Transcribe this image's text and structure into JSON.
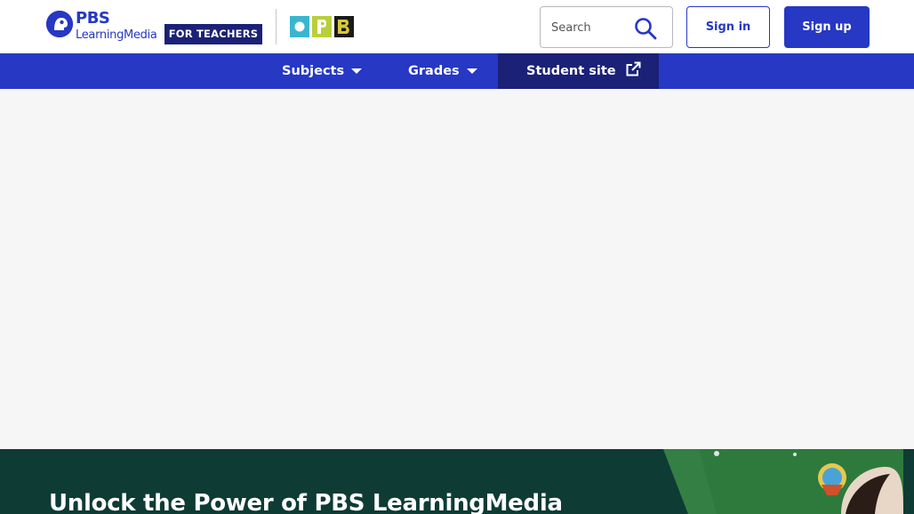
{
  "header": {
    "logo_primary": "PBS",
    "logo_secondary": "LearningMedia",
    "audience_badge": "FOR TEACHERS",
    "partner_logo": "OPB",
    "search": {
      "placeholder": "Search",
      "value": ""
    },
    "signin_label": "Sign in",
    "signup_label": "Sign up"
  },
  "nav": {
    "items": [
      {
        "label": "Subjects",
        "has_dropdown": true
      },
      {
        "label": "Grades",
        "has_dropdown": true
      },
      {
        "label": "Student site",
        "external": true
      }
    ]
  },
  "promo": {
    "title": "Unlock the Power of PBS LearningMedia"
  },
  "icons": {
    "pbs": "pbs-head-icon",
    "search": "search-icon",
    "caret": "caret-down-icon",
    "external": "external-link-icon"
  },
  "colors": {
    "brand_blue": "#2638c4",
    "navy": "#1a2177",
    "promo_green": "#0e3b34",
    "background": "#f6f6f7"
  }
}
